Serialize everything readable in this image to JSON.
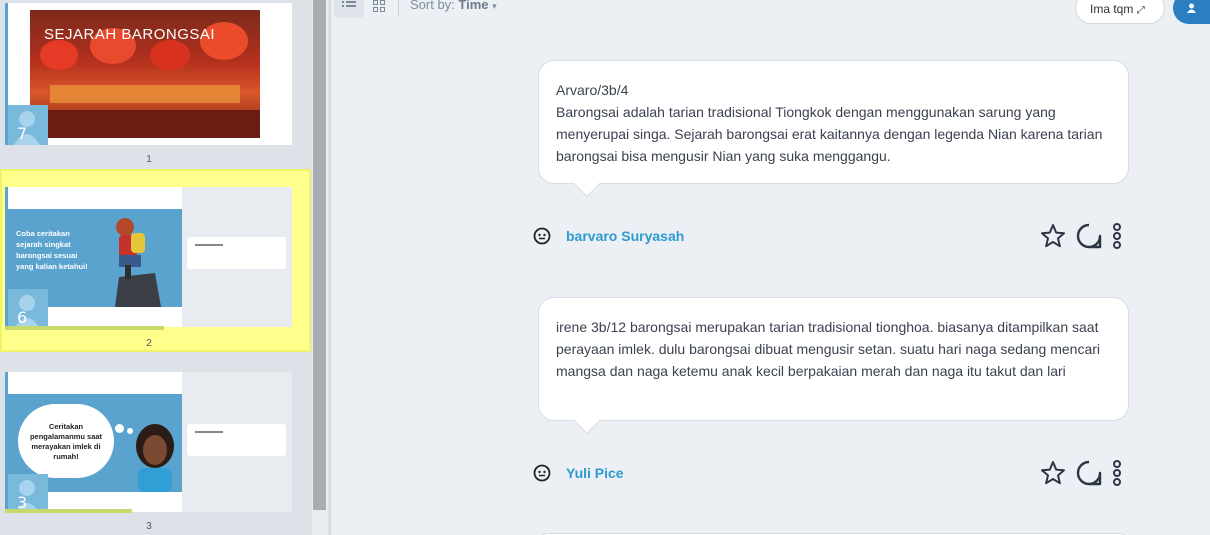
{
  "toolbar": {
    "sort_prefix": "Sort by:",
    "sort_value": "Time",
    "pill_label": "Ima tqm",
    "blue_button_icon": "user-icon"
  },
  "slides": [
    {
      "number": "1",
      "badge": "7",
      "title": "SEJARAH BARONGSAI"
    },
    {
      "number": "2",
      "badge": "6",
      "text": "Coba ceritakan sejarah singkat barongsai sesuai yang kalian ketahui!"
    },
    {
      "number": "3",
      "badge": "3",
      "text": "Ceritakan pengalamanmu saat merayakan imlek di rumah!"
    }
  ],
  "posts": [
    {
      "body": "Arvaro/3b/4\nBarongsai adalah tarian tradisional Tiongkok dengan menggunakan sarung yang menyerupai singa. Sejarah barongsai erat kaitannya dengan legenda Nian karena tarian barongsai bisa mengusir Nian yang suka menggangu.",
      "author": "barvaro Suryasah"
    },
    {
      "body": " irene 3b/12 barongsai merupakan tarian tradisional tionghoa. biasanya ditampilkan saat perayaan imlek. dulu barongsai dibuat mengusir setan. suatu hari naga sedang mencari mangsa dan naga ketemu anak kecil berpakaian merah dan naga itu takut dan lari",
      "author": "Yuli Pice"
    }
  ],
  "colors": {
    "accent": "#2e9bd0",
    "highlight": "#ffff8c",
    "progress": "#c6d96a",
    "slide_blue": "#5aa3cf"
  }
}
